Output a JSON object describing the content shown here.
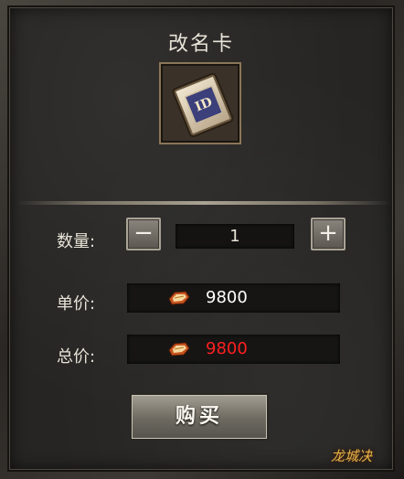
{
  "dialog": {
    "title": "改名卡"
  },
  "item": {
    "icon": "id-card-icon",
    "card_text": "ID"
  },
  "quantity": {
    "label": "数量:",
    "value": "1",
    "minus_label": "−",
    "plus_label": "+"
  },
  "unit_price": {
    "label": "单价:",
    "value": "9800",
    "color": "#ffffff",
    "currency_icon": "ingot-icon"
  },
  "total_price": {
    "label": "总价:",
    "value": "9800",
    "color": "#ff1f1f",
    "currency_icon": "ingot-icon"
  },
  "buy_button": {
    "label": "购买"
  },
  "watermark": {
    "text": "龙城决"
  }
}
